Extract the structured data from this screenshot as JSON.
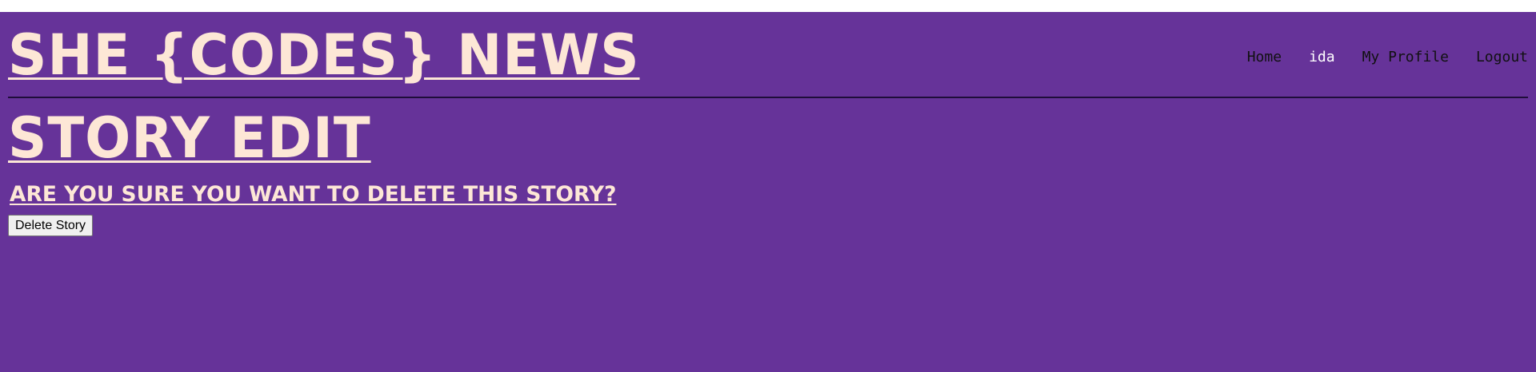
{
  "header": {
    "site_title": "SHE {CODES} NEWS"
  },
  "nav": {
    "home": "Home",
    "user": "ida",
    "profile": "My Profile",
    "logout": "Logout"
  },
  "main": {
    "page_title": "STORY EDIT",
    "confirm_prompt": "ARE YOU SURE YOU WANT TO DELETE THIS STORY?",
    "delete_button_label": "Delete Story"
  },
  "colors": {
    "background": "#663399",
    "title_text": "#fde7d6",
    "nav_text": "#111111",
    "nav_user_text": "#ffffff"
  }
}
